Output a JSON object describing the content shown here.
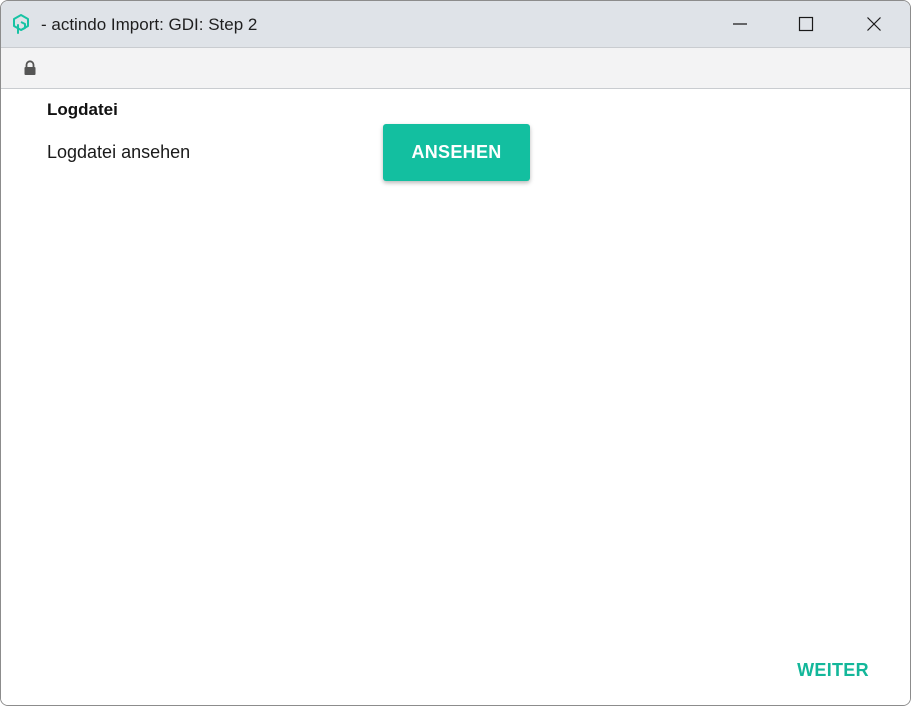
{
  "window": {
    "title": "- actindo Import: GDI: Step 2",
    "app_icon": "actindo-logo-icon",
    "controls": {
      "minimize_icon": "minimize-icon",
      "maximize_icon": "maximize-icon",
      "close_icon": "close-icon"
    }
  },
  "addressbar": {
    "security_icon": "lock-icon"
  },
  "main": {
    "section_title": "Logdatei",
    "log_label": "Logdatei ansehen",
    "view_button_label": "ANSEHEN"
  },
  "footer": {
    "next_button_label": "WEITER"
  },
  "colors": {
    "accent": "#13bfa0",
    "accent_text": "#13b79a",
    "titlebar_bg": "#dfe3e8",
    "addressbar_bg": "#f3f3f4"
  }
}
